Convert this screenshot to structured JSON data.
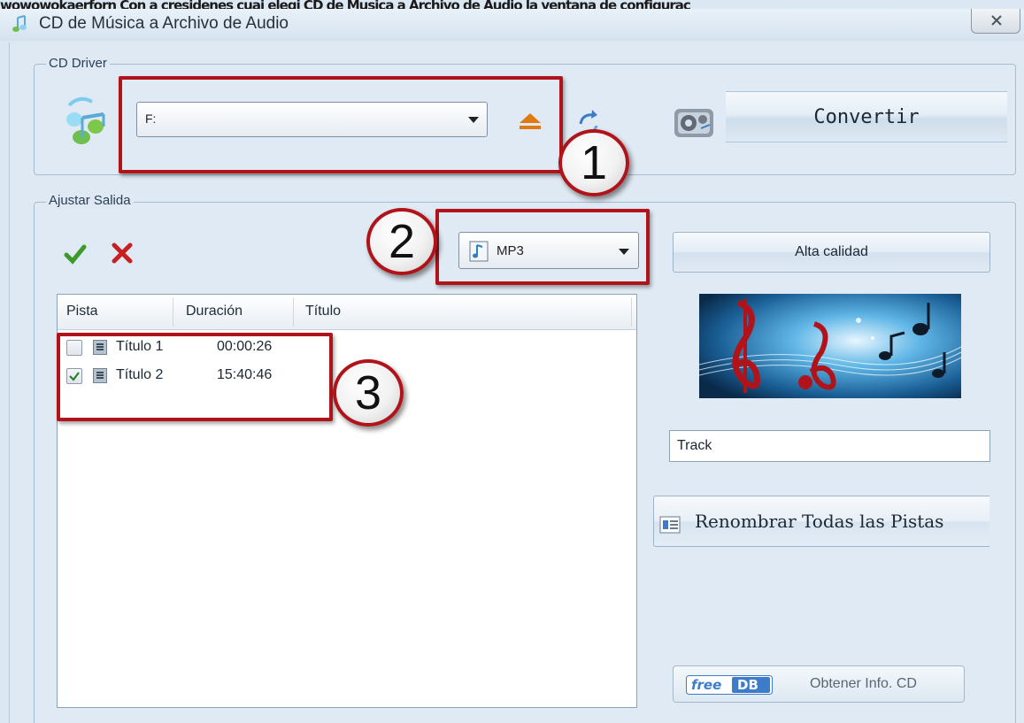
{
  "top_strip": {
    "text": "wowowokaerforn Con a cresidenes cuai elegi CD de Musica a Archivo de Audio la ventana de configurac"
  },
  "window": {
    "title": "CD de Música a Archivo de Audio"
  },
  "cd_driver": {
    "group_label": "CD Driver",
    "drive_value": "F:",
    "convert_label": "Convertir"
  },
  "output": {
    "group_label": "Ajustar Salida",
    "format_value": "MP3",
    "quality_label": "Alta calidad",
    "columns": [
      "Pista",
      "Duración",
      "Título"
    ],
    "tracks": [
      {
        "name": "Título 1",
        "duration": "00:00:26",
        "checked": false
      },
      {
        "name": "Título 2",
        "duration": "15:40:46",
        "checked": true
      }
    ],
    "track_field_value": "Track",
    "rename_label": "Renombrar Todas las Pistas",
    "freedb_logo": "freeDB",
    "freedb_label": "Obtener Info. CD"
  },
  "callouts": [
    "1",
    "2",
    "3"
  ],
  "colors": {
    "callout_red": "#b0141a",
    "check_green": "#3f9a2c",
    "x_red": "#c62020",
    "eject_orange": "#e07a10"
  },
  "icons": {
    "title": "music-notes-icon",
    "drive": "music-notes-icon",
    "eject": "eject-icon",
    "refresh": "refresh-icon",
    "convert": "speaker-icon",
    "select_all": "check-icon",
    "deselect": "x-icon",
    "format": "music-file-icon",
    "track": "track-icon",
    "rename": "document-icon"
  }
}
